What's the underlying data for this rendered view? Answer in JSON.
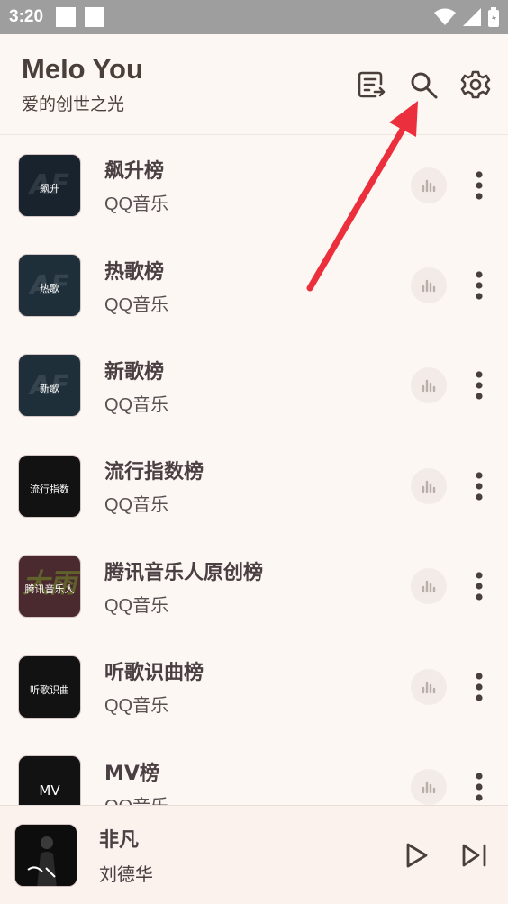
{
  "status_bar": {
    "time": "3:20"
  },
  "header": {
    "title": "Melo You",
    "subtitle": "爱的创世之光",
    "actions": [
      "playlist-export-icon",
      "search-icon",
      "gear-icon"
    ]
  },
  "charts": [
    {
      "title": "飙升榜",
      "source": "QQ音乐",
      "cover_label": "飙升"
    },
    {
      "title": "热歌榜",
      "source": "QQ音乐",
      "cover_label": "热歌"
    },
    {
      "title": "新歌榜",
      "source": "QQ音乐",
      "cover_label": "新歌"
    },
    {
      "title": "流行指数榜",
      "source": "QQ音乐",
      "cover_label": "流行指数"
    },
    {
      "title": "腾讯音乐人原创榜",
      "source": "QQ音乐",
      "cover_label": "腾讯音乐人"
    },
    {
      "title": "听歌识曲榜",
      "source": "QQ音乐",
      "cover_label": "听歌识曲"
    },
    {
      "title": "MV榜",
      "source": "QQ音乐",
      "cover_label": "MV"
    }
  ],
  "player": {
    "song_title": "非凡",
    "artist": "刘德华"
  },
  "colors": {
    "background": "#fdf7f3",
    "annotation_arrow": "#ec2f3c",
    "status_bar": "#9e9e9e"
  }
}
